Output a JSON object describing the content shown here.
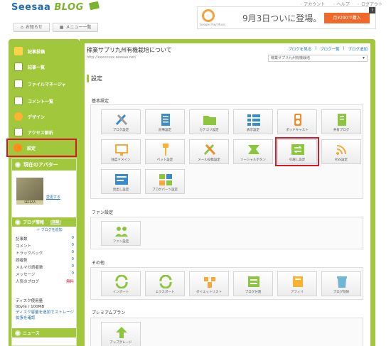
{
  "header": {
    "logo_main": "Seesaa",
    "logo_blog": "BLOG",
    "top_links": [
      "アカウント",
      "ヘルプ",
      "ログアウト"
    ],
    "nav_tabs": [
      "お知らせ",
      "メニュー一覧"
    ]
  },
  "ad": {
    "brand": "Google Play Music",
    "text": "9月3日ついに登場。",
    "button": "月¥290で購入",
    "corner": "i"
  },
  "sidebar": {
    "items": [
      {
        "label": "記事投稿",
        "icon": "pencil-icon",
        "color": "#ffd24a"
      },
      {
        "label": "記事一覧",
        "icon": "document-icon",
        "color": "#ffffff"
      },
      {
        "label": "ファイルマネージャ",
        "icon": "folder-icon",
        "color": "#ffffff"
      },
      {
        "label": "コメント一覧",
        "icon": "comment-icon",
        "color": "#ffffff"
      },
      {
        "label": "デザイン",
        "icon": "palette-icon",
        "color": "#ffb133"
      },
      {
        "label": "アクセス解析",
        "icon": "chart-icon",
        "color": "#ffffff"
      },
      {
        "label": "設定",
        "icon": "settings-icon",
        "color": "#ff8c1a"
      }
    ],
    "avatar_section_title": "現在のアバター",
    "avatar_badge": "SEESAA",
    "avatar_link": "変更する",
    "blog_info_title": "ブログ情報",
    "blog_info_link": "[詳細]",
    "add_link": "ブログを追加",
    "stats": [
      {
        "label": "記事数",
        "value": "0"
      },
      {
        "label": "コメント",
        "value": "0"
      },
      {
        "label": "トラックバック",
        "value": "0"
      },
      {
        "label": "読者数",
        "value": "0"
      },
      {
        "label": "メルマガ読者数",
        "value": "0"
      },
      {
        "label": "メッセージ",
        "value": "0"
      },
      {
        "label": "人気のブログ",
        "value": "無料"
      }
    ],
    "disk_label": "ディスク使用量",
    "disk_value": "0byte / 100MB",
    "disk_link": "ディスク容量を追加でストレージ拡張を確認",
    "news_title": "ニュース"
  },
  "main": {
    "blog_title": "稼業サプリ九州有機栽培について",
    "blog_url": "http://xxxxxxxx.seesaa.net/",
    "links": [
      "ブログを見る",
      "ブログ一覧",
      "ブログ追加"
    ],
    "blog_select": "稼業サプリ九州有機栽培",
    "page_title": "設定",
    "sections": {
      "basic": {
        "label": "基本設定",
        "tiles": [
          {
            "label": "ブログ設定",
            "icon": "tools-icon"
          },
          {
            "label": "記事設定",
            "icon": "article-icon"
          },
          {
            "label": "カテゴリ設定",
            "icon": "folder-icon"
          },
          {
            "label": "表示設定",
            "icon": "list-icon"
          },
          {
            "label": "ポッドキャスト",
            "icon": "ipod-icon"
          },
          {
            "label": "共有ブログ",
            "icon": "notebook-icon"
          },
          {
            "label": "独自ドメイン",
            "icon": "domain-icon"
          },
          {
            "label": "ペット設定",
            "icon": "key-icon"
          },
          {
            "label": "メール投稿設定",
            "icon": "mail-tools-icon"
          },
          {
            "label": "ソーシャルボタン",
            "icon": "social-icon"
          },
          {
            "label": "引越し設定",
            "icon": "transfer-icon"
          },
          {
            "label": "RSS設定",
            "icon": "rss-icon"
          },
          {
            "label": "見出し設定",
            "icon": "heading-icon"
          },
          {
            "label": "ブログパーツ設定",
            "icon": "parts-icon"
          }
        ]
      },
      "fan": {
        "label": "ファン設定",
        "tiles": [
          {
            "label": "ファン設定",
            "icon": "people-icon"
          }
        ]
      },
      "other": {
        "label": "その他",
        "tiles": [
          {
            "label": "インポート",
            "icon": "import-icon"
          },
          {
            "label": "エクスポート",
            "icon": "export-icon"
          },
          {
            "label": "ダイエットリスト",
            "icon": "diet-icon"
          },
          {
            "label": "ブログ分割",
            "icon": "split-icon"
          },
          {
            "label": "アフィリ",
            "icon": "affiliate-icon"
          },
          {
            "label": "ブログ削除",
            "icon": "trash-icon"
          }
        ]
      },
      "premium": {
        "label": "プレミアムプラン",
        "tiles": [
          {
            "label": "アップグレード",
            "icon": "upgrade-icon"
          }
        ]
      }
    }
  }
}
